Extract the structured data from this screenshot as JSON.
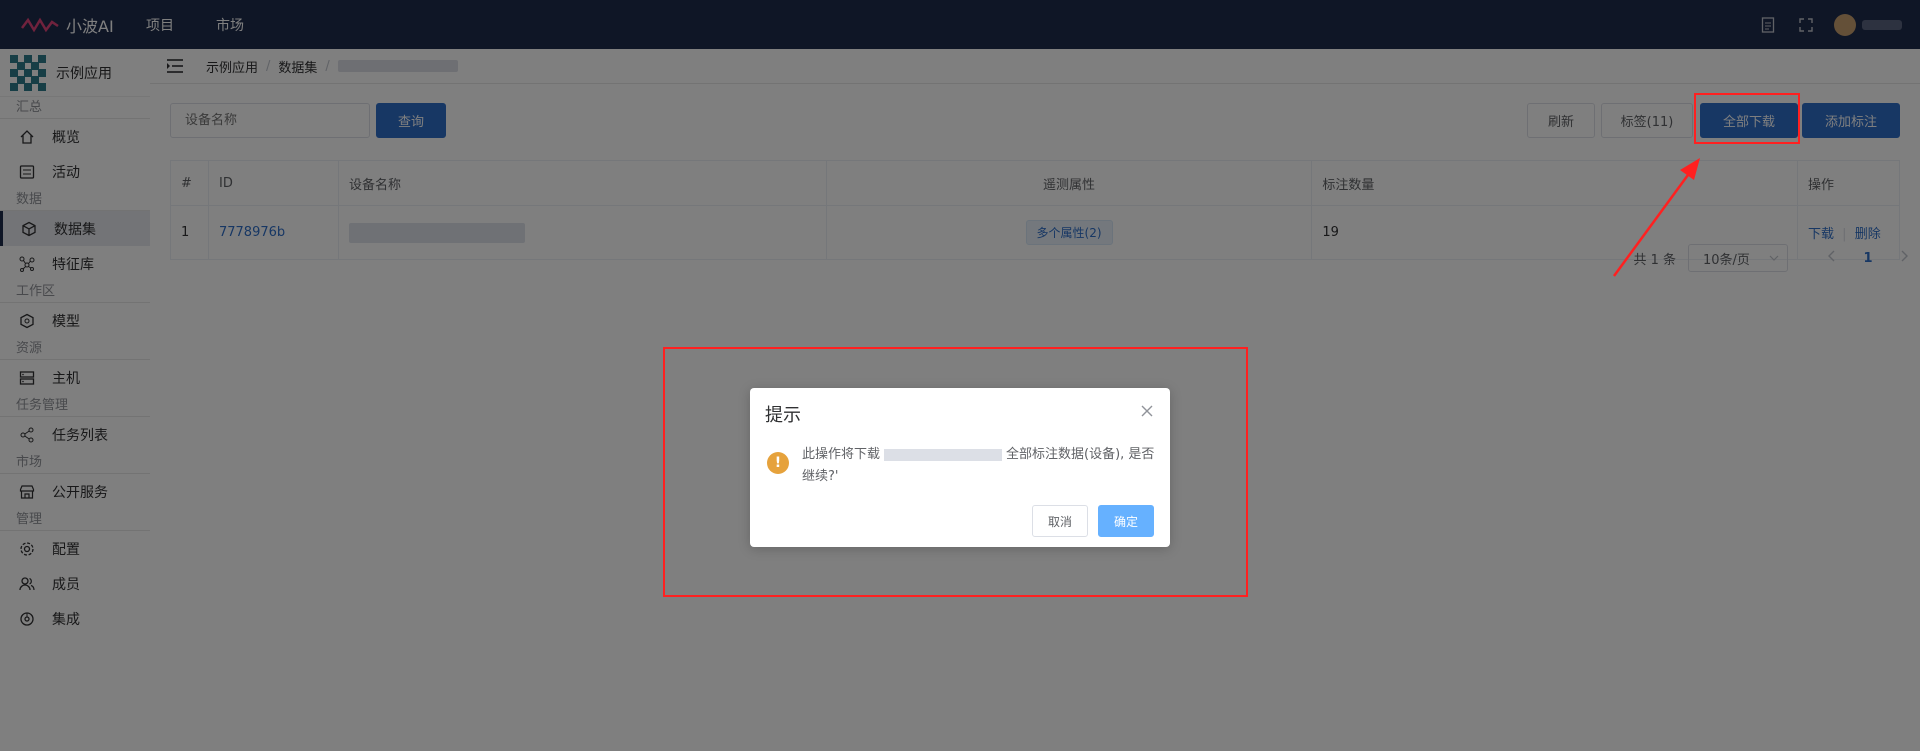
{
  "header": {
    "logo_text": "小波AI",
    "menu": [
      "项目",
      "市场"
    ]
  },
  "sidebar": {
    "app_name": "示例应用",
    "groups": {
      "summary": "汇总",
      "data": "数据",
      "workspace": "工作区",
      "resource": "资源",
      "task": "任务管理",
      "market": "市场",
      "manage": "管理"
    },
    "items": {
      "overview": "概览",
      "activity": "活动",
      "dataset": "数据集",
      "feature": "特征库",
      "model": "模型",
      "host": "主机",
      "task_list": "任务列表",
      "public_service": "公开服务",
      "config": "配置",
      "member": "成员",
      "integration": "集成"
    }
  },
  "breadcrumb": {
    "items": [
      "示例应用",
      "数据集"
    ],
    "separator": "/"
  },
  "toolbar": {
    "search_placeholder": "设备名称",
    "query": "查询",
    "refresh": "刷新",
    "tags": "标签(11)",
    "download_all": "全部下载",
    "add_label": "添加标注"
  },
  "table": {
    "headers": [
      "#",
      "ID",
      "设备名称",
      "遥测属性",
      "标注数量",
      "操作"
    ],
    "rows": [
      {
        "index": "1",
        "id": "7778976b",
        "telemetry": "多个属性(2)",
        "label_count": "19",
        "action_download": "下载",
        "action_sep": "|",
        "action_delete": "删除"
      }
    ]
  },
  "pagination": {
    "total": "共 1 条",
    "page_size": "10条/页",
    "current": "1"
  },
  "dialog": {
    "title": "提示",
    "message_prefix": "此操作将下载",
    "message_suffix": "全部标注数据(设备), 是否继续?'",
    "cancel": "取消",
    "confirm": "确定"
  },
  "colors": {
    "topbar": "#1f2d4d",
    "primary": "#2f6fc9",
    "confirm": "#66b1ff",
    "warning": "#e6a23c",
    "annotation": "#ff2020"
  }
}
